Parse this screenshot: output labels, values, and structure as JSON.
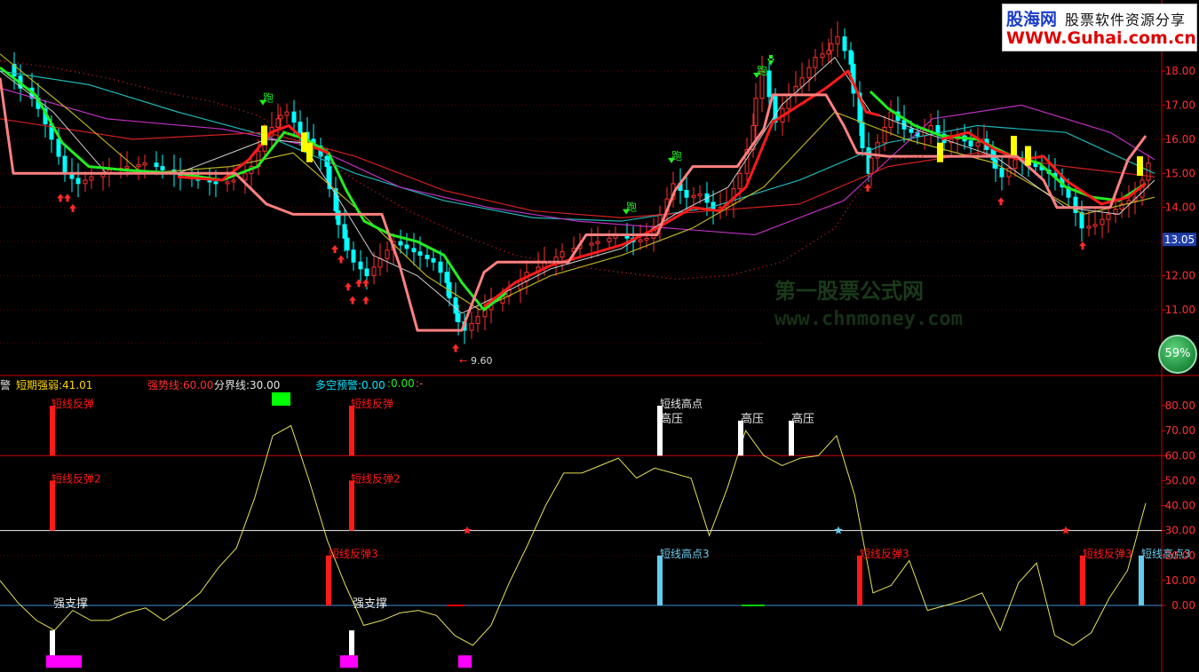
{
  "logo": {
    "name": "股海网",
    "slogan": "股票软件资源分享",
    "url": "WWW.Guhai.com.cn"
  },
  "watermark": {
    "line1": "第一股票公式网",
    "line2": "www.chnmoney.com"
  },
  "badge": {
    "value": "59%"
  },
  "price_axis": {
    "ticks": [
      "18.00",
      "17.00",
      "16.00",
      "15.00",
      "14.00",
      "13.00",
      "12.00",
      "11.00"
    ],
    "current_price": "13.05",
    "low_marker": "9.60"
  },
  "indicator_axis": {
    "ticks": [
      "80.00",
      "70.00",
      "60.00",
      "50.00",
      "40.00",
      "30.00",
      "20.00",
      "10.00",
      "0.00"
    ]
  },
  "indicator_header": {
    "prefix": "警",
    "item1": "短期强弱:41.01",
    "item2": "强势线:60.00",
    "item3": "分界线:30.00",
    "item4": "多空预警:0.00",
    "item5": ":0.00",
    "item6": ":-"
  },
  "labels": {
    "run": "跑",
    "rebound": "短线反弹",
    "rebound2": "短线反弹2",
    "rebound3": "短线反弹3",
    "short_high": "短线高点",
    "short_high3": "短线高点3",
    "pressure": "高压",
    "support": "强支撑"
  },
  "colors": {
    "up": "#ff3030",
    "down": "#00ffff",
    "ma_green": "#22ee22",
    "ma_red": "#ff1a1a",
    "ma_pink": "#ff8080",
    "oscillator": "#e6e05a",
    "grid": "#d00000"
  },
  "chart_data": [
    {
      "type": "candlestick",
      "yrange": [
        10.0,
        19.0
      ],
      "current_price": 13.05,
      "low": 9.6,
      "high": 19.1,
      "overlays": [
        "moving averages",
        "step support line",
        "trend dots"
      ]
    },
    {
      "type": "line",
      "series": [
        {
          "name": "短期强弱",
          "values": [
            10,
            1,
            -6,
            -10,
            -2,
            -6,
            -6,
            -3,
            -1,
            -6,
            -1,
            5,
            15,
            23,
            43,
            68,
            72,
            50,
            26,
            8,
            -8,
            -6,
            -3,
            -2,
            -4,
            -12,
            -16,
            -8,
            9,
            24,
            40,
            53,
            53,
            56,
            59,
            51,
            55,
            53,
            51,
            28,
            47,
            70,
            60,
            56,
            59,
            60,
            68,
            44,
            5,
            8,
            18,
            -2,
            0,
            2,
            5,
            -10,
            9,
            17,
            -12,
            -16,
            -11,
            3,
            14,
            41
          ]
        }
      ],
      "reference_lines": {
        "强势线": 60.0,
        "分界线": 30.0,
        "zero": 0.0
      },
      "ylim": [
        -15,
        85
      ]
    }
  ]
}
